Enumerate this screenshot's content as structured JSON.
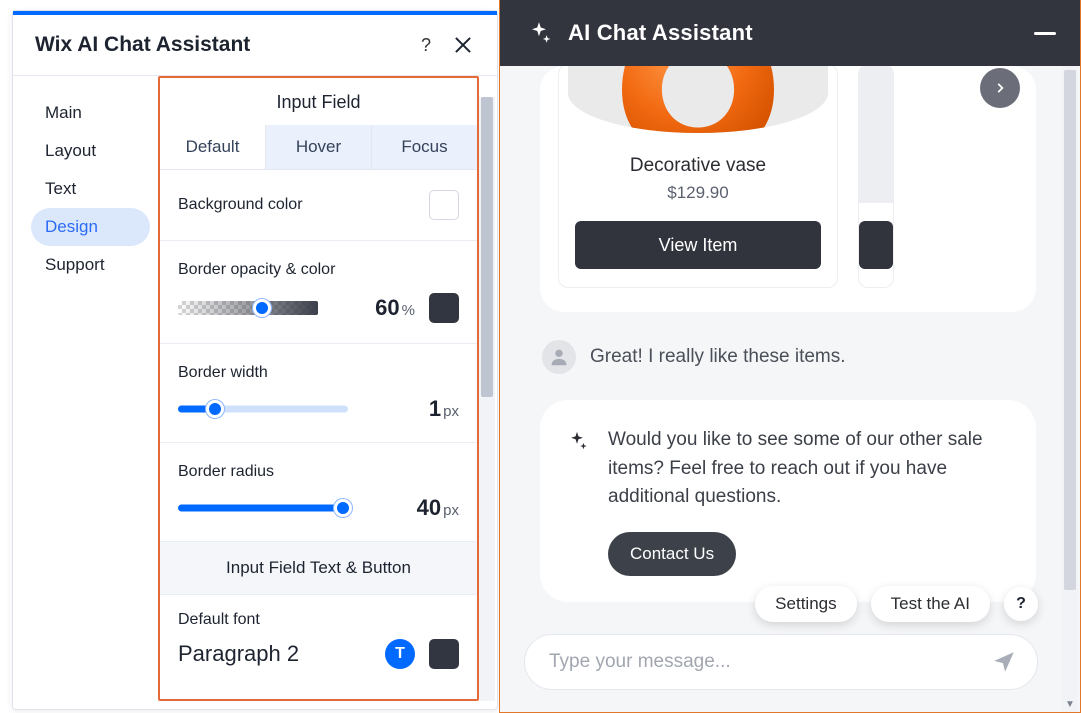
{
  "panel": {
    "title": "Wix AI Chat Assistant",
    "help_tooltip": "?",
    "sidebar": {
      "items": [
        {
          "label": "Main"
        },
        {
          "label": "Layout"
        },
        {
          "label": "Text"
        },
        {
          "label": "Design"
        },
        {
          "label": "Support"
        }
      ],
      "active_index": 3
    },
    "section_title": "Input Field",
    "tabs": [
      {
        "label": "Default"
      },
      {
        "label": "Hover"
      },
      {
        "label": "Focus"
      }
    ],
    "active_tab": 0,
    "fields": {
      "bg_color_label": "Background color",
      "bg_color_value": "#ffffff",
      "border_opacity_label": "Border opacity & color",
      "border_opacity_value": "60",
      "border_opacity_unit": "%",
      "border_color_value": "#323641",
      "border_width_label": "Border width",
      "border_width_value": "1",
      "border_width_unit": "px",
      "border_radius_label": "Border radius",
      "border_radius_value": "40",
      "border_radius_unit": "px"
    },
    "subheader": "Input Field Text & Button",
    "font": {
      "label": "Default font",
      "value": "Paragraph 2",
      "t_badge": "T",
      "color_value": "#323641"
    }
  },
  "chat": {
    "header_title": "AI Chat Assistant",
    "product": {
      "name": "Decorative vase",
      "price": "$129.90",
      "view_label": "View Item"
    },
    "user_message": "Great! I really like these items.",
    "bot_message": "Would you like to see some of our other sale items? Feel free to reach out if you have additional questions.",
    "contact_label": "Contact Us",
    "chips": {
      "settings": "Settings",
      "test": "Test the AI",
      "help": "?"
    },
    "composer": {
      "placeholder": "Type your message..."
    }
  }
}
